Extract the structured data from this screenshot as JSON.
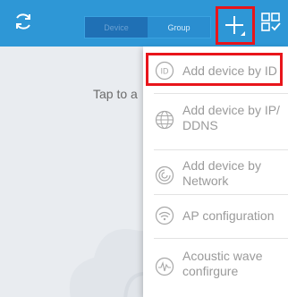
{
  "topbar": {
    "tab_device": "Device",
    "tab_group": "Group",
    "icons": {
      "refresh": "refresh-icon",
      "add": "plus-icon",
      "grid": "grid-check-icon"
    },
    "colors": {
      "bar": "#2e97d6",
      "highlight": "#e8151b"
    }
  },
  "main": {
    "hint_text": "Tap to a"
  },
  "menu": {
    "items": [
      {
        "icon": "id-icon",
        "line1": "Add device by ID",
        "line2": ""
      },
      {
        "icon": "globe-icon",
        "line1": "Add device by IP/",
        "line2": "DDNS"
      },
      {
        "icon": "network-icon",
        "line1": "Add device by",
        "line2": "Network"
      },
      {
        "icon": "wifi-icon",
        "line1": "AP configuration",
        "line2": ""
      },
      {
        "icon": "soundwave-icon",
        "line1": "Acoustic wave",
        "line2": "confirgure"
      }
    ]
  }
}
